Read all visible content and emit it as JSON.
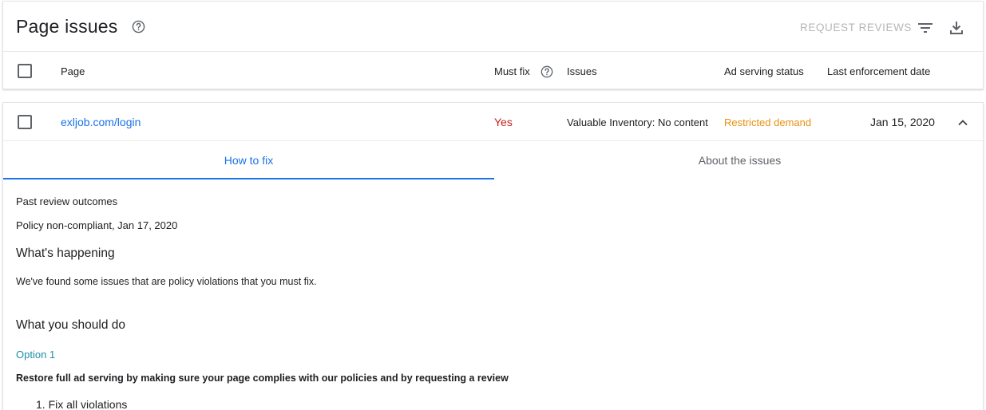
{
  "header": {
    "title": "Page issues",
    "request_reviews_label": "REQUEST REVIEWS"
  },
  "table": {
    "columns": {
      "page": "Page",
      "must_fix": "Must fix",
      "issues": "Issues",
      "ad_serving_status": "Ad serving status",
      "last_enforcement_date": "Last enforcement date"
    },
    "rows": [
      {
        "page": "exljob.com/login",
        "must_fix": "Yes",
        "issues": "Valuable Inventory: No content",
        "ad_serving_status": "Restricted demand",
        "last_enforcement_date": "Jan 15, 2020"
      }
    ]
  },
  "detail": {
    "tabs": [
      {
        "label": "How to fix",
        "selected": true
      },
      {
        "label": "About the issues",
        "selected": false
      }
    ],
    "past_review_heading": "Past review outcomes",
    "past_review_value": "Policy non-compliant, Jan 17, 2020",
    "whats_happening_heading": "What's happening",
    "whats_happening_body": "We've found some issues that are policy violations that you must fix.",
    "what_to_do_heading": "What you should do",
    "option_label": "Option 1",
    "option_body": "Restore full ad serving by making sure your page complies with our policies and by requesting a review",
    "steps": [
      "1. Fix all violations"
    ]
  },
  "colors": {
    "link": "#1a73e8",
    "must_fix": "#c5221f",
    "restricted_demand": "#e8910f",
    "option": "#1b8fa8",
    "disabled_button": "#b6b6b6"
  },
  "icons": [
    "help-icon",
    "filter-icon",
    "download-icon",
    "chevron-up-icon",
    "checkbox-icon"
  ]
}
